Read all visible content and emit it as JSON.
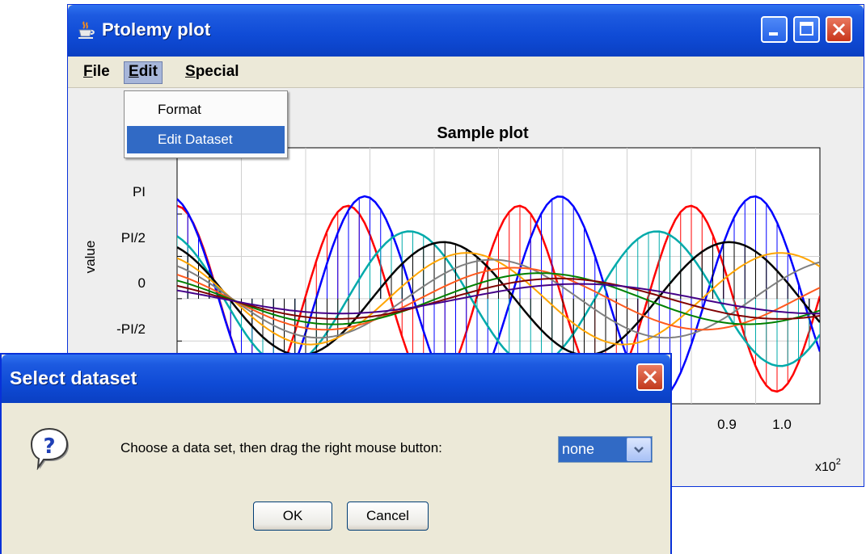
{
  "main_window": {
    "title": "Ptolemy plot",
    "menu": [
      {
        "label_first": "F",
        "label_rest": "ile"
      },
      {
        "label_first": "E",
        "label_rest": "dit"
      },
      {
        "label_first": "S",
        "label_rest": "pecial"
      }
    ]
  },
  "edit_menu": {
    "items": [
      "Format",
      "Edit Dataset"
    ],
    "selected": "Edit Dataset"
  },
  "chart_data": {
    "type": "line",
    "title": "Sample plot",
    "ylabel": "value",
    "xlabel": "",
    "y_ticks": [
      "PI",
      "PI/2",
      "0",
      "-PI/2"
    ],
    "y_tick_values": [
      3.1416,
      1.5708,
      0,
      -1.5708
    ],
    "x_ticks": [
      "0.9",
      "1.0"
    ],
    "x_tick_values": [
      0.9,
      1.0
    ],
    "x_tick_partial": "8",
    "x_multiplier": "x10",
    "x_multiplier_exp": "2",
    "x_range": [
      0,
      1.0
    ],
    "y_range": [
      -3.9,
      5.6
    ],
    "grid": true,
    "impulses": true,
    "series": [
      {
        "color": "#ff0000",
        "freq": 7.5,
        "amp": 6.9,
        "phase": 0.5
      },
      {
        "color": "#0000ff",
        "freq": 6.6,
        "amp": 7.6,
        "phase": 0.7
      },
      {
        "color": "#00aaaa",
        "freq": 5.2,
        "amp": 5.0,
        "phase": 0.85
      },
      {
        "color": "#000000",
        "freq": 4.5,
        "amp": 4.2,
        "phase": 0.9
      },
      {
        "color": "#ffa500",
        "freq": 4.1,
        "amp": 3.4,
        "phase": 0.95
      },
      {
        "color": "#808080",
        "freq": 3.7,
        "amp": 2.9,
        "phase": 1.05
      },
      {
        "color": "#ff5a1e",
        "freq": 3.4,
        "amp": 2.3,
        "phase": 1.15
      },
      {
        "color": "#008000",
        "freq": 3.1,
        "amp": 1.9,
        "phase": 1.25
      },
      {
        "color": "#800000",
        "freq": 2.9,
        "amp": 1.5,
        "phase": 1.35
      },
      {
        "color": "#440088",
        "freq": 2.7,
        "amp": 1.1,
        "phase": 1.45
      }
    ],
    "impulse_series": [
      "#ff0000",
      "#0000ff",
      "#00aaaa",
      "#000000"
    ]
  },
  "dialog": {
    "title": "Select dataset",
    "message": "Choose a data set, then drag the right mouse button:",
    "combo_value": "none",
    "ok_label": "OK",
    "cancel_label": "Cancel"
  }
}
